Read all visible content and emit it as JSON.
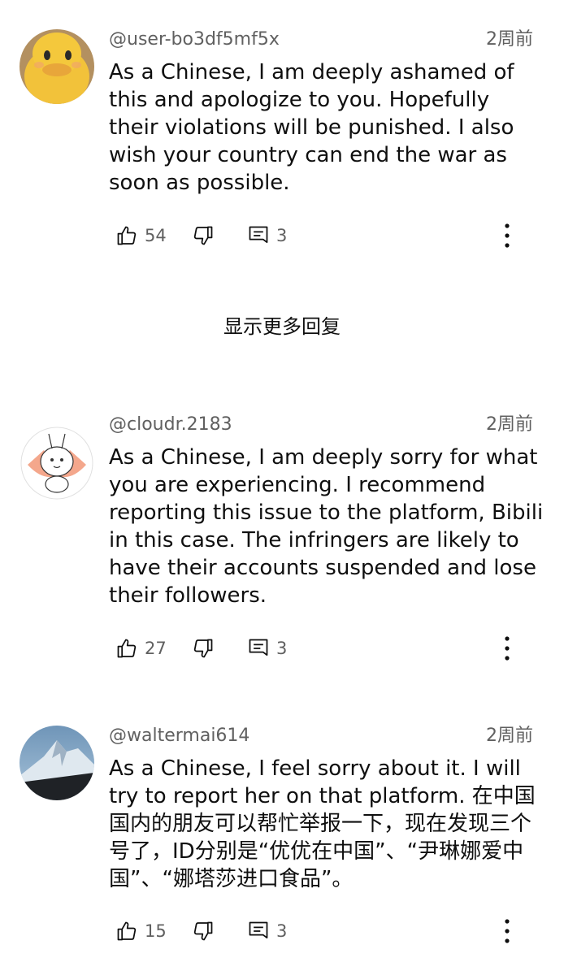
{
  "comments": [
    {
      "handle": "@user-bo3df5mf5x",
      "time": "2周前",
      "text": "As a Chinese, I am deeply ashamed of this and apologize to you. Hopefully their violations will be punished. I also wish your country can end the war as soon as possible.",
      "likes": "54",
      "replies": "3",
      "avatar": "yellow-duck-avatar"
    },
    {
      "handle": "@cloudr.2183",
      "time": "2周前",
      "text": "As a Chinese, I am deeply sorry for what you are experiencing. I recommend reporting this issue to the platform, Bibili in this case. The infringers are likely to have their accounts suspended and lose their followers.",
      "likes": "27",
      "replies": "3",
      "avatar": "cartoon-rabbit-avatar"
    },
    {
      "handle": "@waltermai614",
      "time": "2周前",
      "text": "As a Chinese, I feel sorry about it. I will try to report her on that platform. 在中国国内的朋友可以帮忙举报一下，现在发现三个号了，ID分别是“优优在中国”、“尹琳娜爱中国”、“娜塔莎进口食品”。",
      "likes": "15",
      "replies": "3",
      "avatar": "snowy-mountain-avatar"
    }
  ],
  "show_more_replies": "显示更多回复",
  "colors": {
    "text": "#0f0f0f",
    "secondary": "#606060",
    "background": "#ffffff"
  }
}
